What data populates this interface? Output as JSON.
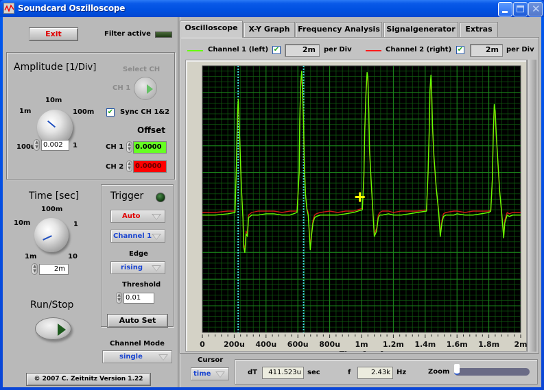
{
  "window": {
    "title": "Soundcard Oszilloscope",
    "controls": {
      "minimize": "minimize-icon",
      "maximize": "maximize-icon",
      "close": "close-icon"
    }
  },
  "left_panel": {
    "exit_label": "Exit",
    "filter_label": "Filter active",
    "amplitude": {
      "title": "Amplitude",
      "unit": "[1/Div]",
      "scale_labels": [
        "100u",
        "1m",
        "10m",
        "100m",
        "1"
      ],
      "value": "0.002"
    },
    "select_ch": {
      "title": "Select CH",
      "value_label": "CH 1"
    },
    "sync": {
      "label": "Sync CH 1&2",
      "checked": true
    },
    "offset": {
      "title": "Offset",
      "ch1_label": "CH 1",
      "ch1_value": "0.0000",
      "ch2_label": "CH 2",
      "ch2_value": "0.0000"
    },
    "time": {
      "title": "Time [sec]",
      "scale_labels": [
        "1m",
        "10m",
        "100m",
        "1",
        "10"
      ],
      "value": "2m"
    },
    "trigger": {
      "title": "Trigger",
      "mode": "Auto",
      "channel": "Channel 1",
      "edge_label": "Edge",
      "edge": "rising",
      "threshold_label": "Threshold",
      "threshold": "0.01",
      "auto_set_label": "Auto Set"
    },
    "run_stop_label": "Run/Stop",
    "channel_mode": {
      "label": "Channel Mode",
      "value": "single"
    },
    "copyright": "© 2007   C. Zeitnitz Version 1.22"
  },
  "tabs": [
    {
      "label": "Oscilloscope",
      "active": true
    },
    {
      "label": "X-Y Graph",
      "active": false
    },
    {
      "label": "Frequency Analysis",
      "active": false
    },
    {
      "label": "Signalgenerator",
      "active": false
    },
    {
      "label": "Extras",
      "active": false
    }
  ],
  "channels": [
    {
      "label": "Channel 1 (left)",
      "color": "#66ff00",
      "enabled": true,
      "per_div": "2m",
      "per_div_label": "per Div"
    },
    {
      "label": "Channel 2 (right)",
      "color": "#ff1a1a",
      "enabled": true,
      "per_div": "2m",
      "per_div_label": "per Div"
    }
  ],
  "cursor_panel": {
    "label": "Cursor",
    "mode": "time",
    "dt_label": "dT",
    "dt_value": "411.523u",
    "dt_unit": "sec",
    "f_label": "f",
    "f_value": "2.43k",
    "f_unit": "Hz",
    "zoom_label": "Zoom",
    "zoom_level": 0.0
  },
  "chart_data": {
    "type": "line",
    "title": "",
    "xlabel": "Time [sec]",
    "ylabel": "",
    "x_unit": "sec",
    "xlim": [
      0,
      0.002
    ],
    "ylim": [
      -10,
      10
    ],
    "y_unit": "mV (2m per Div, 10 divisions)",
    "x_ticks": [
      0,
      0.0002,
      0.0004,
      0.0006,
      0.0008,
      0.001,
      0.0012,
      0.0014,
      0.0016,
      0.0018,
      0.002
    ],
    "x_tick_labels": [
      "0",
      "200u",
      "400u",
      "600u",
      "800u",
      "1m",
      "1.2m",
      "1.4m",
      "1.6m",
      "1.8m",
      "2m"
    ],
    "grid": true,
    "background": "#000000",
    "grid_color": "#0f5a0f",
    "cursors": [
      {
        "x": 0.000225,
        "color": "#40e0e0",
        "style": "dotted"
      },
      {
        "x": 0.000636,
        "color": "#40e0e0",
        "style": "dotted"
      }
    ],
    "cursor_marker": {
      "x": 0.00099,
      "y": 0.0,
      "color": "#ffff00"
    },
    "series": [
      {
        "name": "Channel 1 (left)",
        "color": "#66ff00",
        "x": [
          0,
          8e-05,
          0.00016,
          0.000205,
          0.000214,
          0.000218,
          0.000222,
          0.000226,
          0.00023,
          0.000236,
          0.000245,
          0.000255,
          0.00026,
          0.000267,
          0.000275,
          0.000283,
          0.00029,
          0.00031,
          0.00035,
          0.0004,
          0.00045,
          0.0005,
          0.00055,
          0.000595,
          0.000608,
          0.000612,
          0.000618,
          0.000624,
          0.00063,
          0.000636,
          0.00064,
          0.000648,
          0.000657,
          0.000665,
          0.000678,
          0.000686,
          0.000695,
          0.000705,
          0.000715,
          0.00074,
          0.0008,
          0.00085,
          0.0009,
          0.00095,
          0.001005,
          0.001015,
          0.00102,
          0.001028,
          0.001035,
          0.00104,
          0.001046,
          0.00105,
          0.00106,
          0.00107,
          0.00108,
          0.001095,
          0.001105,
          0.001115,
          0.00113,
          0.00117,
          0.0012,
          0.00125,
          0.0013,
          0.00135,
          0.001408,
          0.001418,
          0.001425,
          0.00143,
          0.001436,
          0.00144,
          0.001446,
          0.001455,
          0.00147,
          0.001485,
          0.001495,
          0.001505,
          0.001515,
          0.00153,
          0.00158,
          0.0016,
          0.00165,
          0.0017,
          0.00175,
          0.0018,
          0.001812,
          0.001822,
          0.001828,
          0.001834,
          0.00184,
          0.001846,
          0.001856,
          0.001868,
          0.00188,
          0.001893,
          0.0019,
          0.001915,
          0.001928,
          0.00195,
          0.002
        ],
        "y": [
          -1.2,
          -1.2,
          -1.1,
          -1.0,
          2.5,
          5.0,
          6.8,
          7.5,
          6.2,
          4.0,
          1.0,
          -1.5,
          -3.6,
          -4.0,
          -2.6,
          -2.8,
          -1.4,
          -1.2,
          -1.2,
          -1.1,
          -1.1,
          -1.2,
          -1.2,
          -1.0,
          2.0,
          6.0,
          8.8,
          9.6,
          8.0,
          5.5,
          3.0,
          0.4,
          -0.8,
          -1.2,
          -3.8,
          -2.7,
          -1.8,
          -1.4,
          -1.3,
          -1.2,
          -1.2,
          -1.2,
          -1.1,
          -1.0,
          -0.8,
          1.8,
          5.0,
          8.0,
          9.5,
          9.1,
          6.5,
          3.8,
          1.5,
          -0.6,
          -2.8,
          -2.4,
          -1.4,
          -1.2,
          -1.2,
          -1.1,
          -1.2,
          -1.2,
          -1.1,
          -1.0,
          -0.9,
          2.0,
          5.0,
          8.2,
          9.3,
          8.4,
          5.5,
          3.2,
          0.8,
          -1.0,
          -2.8,
          -1.8,
          -1.3,
          -1.2,
          -1.2,
          -1.1,
          -1.2,
          -1.2,
          -1.1,
          -1.0,
          -0.9,
          1.5,
          5.0,
          7.1,
          6.6,
          5.0,
          3.0,
          0.6,
          -1.0,
          -2.9,
          -1.8,
          -1.2,
          -1.3,
          -1.2,
          -1.2
        ]
      },
      {
        "name": "Channel 2 (right)",
        "color": "#ff1a1a",
        "x": [
          0,
          8e-05,
          0.00016,
          0.000205,
          0.000214,
          0.000218,
          0.000222,
          0.000226,
          0.00023,
          0.000236,
          0.000245,
          0.000255,
          0.00026,
          0.000267,
          0.000275,
          0.000283,
          0.00029,
          0.00031,
          0.00035,
          0.0004,
          0.00045,
          0.0005,
          0.00055,
          0.000595,
          0.000608,
          0.000612,
          0.000618,
          0.000624,
          0.00063,
          0.000636,
          0.00064,
          0.000648,
          0.000657,
          0.000665,
          0.000678,
          0.000686,
          0.000695,
          0.000705,
          0.000715,
          0.00074,
          0.0008,
          0.00085,
          0.0009,
          0.00095,
          0.001005,
          0.001015,
          0.00102,
          0.001028,
          0.001035,
          0.00104,
          0.001046,
          0.00105,
          0.00106,
          0.00107,
          0.00108,
          0.001095,
          0.001105,
          0.001115,
          0.00113,
          0.00117,
          0.0012,
          0.00125,
          0.0013,
          0.00135,
          0.001408,
          0.001418,
          0.001425,
          0.00143,
          0.001436,
          0.00144,
          0.001446,
          0.001455,
          0.00147,
          0.001485,
          0.001495,
          0.001505,
          0.001515,
          0.00153,
          0.00158,
          0.0016,
          0.00165,
          0.0017,
          0.00175,
          0.0018,
          0.001812,
          0.001822,
          0.001828,
          0.001834,
          0.00184,
          0.001846,
          0.001856,
          0.001868,
          0.00188,
          0.001893,
          0.0019,
          0.001915,
          0.001928,
          0.00195,
          0.002
        ],
        "y": [
          -1.0,
          -1.0,
          -0.9,
          -0.9,
          2.4,
          4.8,
          6.5,
          7.3,
          6.0,
          3.8,
          0.9,
          -1.4,
          -3.4,
          -3.8,
          -2.4,
          -2.6,
          -1.2,
          -1.0,
          -0.9,
          -0.9,
          -0.9,
          -1.0,
          -0.9,
          -0.9,
          1.9,
          5.8,
          8.5,
          9.3,
          7.8,
          5.3,
          2.8,
          0.3,
          -0.7,
          -1.0,
          -3.6,
          -2.5,
          -1.6,
          -1.2,
          -1.1,
          -1.0,
          -0.9,
          -1.0,
          -0.9,
          -0.9,
          -0.7,
          1.7,
          4.8,
          7.8,
          9.3,
          8.9,
          6.3,
          3.6,
          1.4,
          -0.5,
          -2.6,
          -2.2,
          -1.2,
          -1.0,
          -0.9,
          -0.9,
          -1.0,
          -0.9,
          -0.9,
          -0.9,
          -0.8,
          1.9,
          4.8,
          8.0,
          9.1,
          8.2,
          5.3,
          3.0,
          0.7,
          -0.9,
          -2.6,
          -1.6,
          -1.1,
          -1.0,
          -0.9,
          -0.9,
          -1.0,
          -0.9,
          -0.9,
          -0.9,
          -0.8,
          1.4,
          4.8,
          6.9,
          6.4,
          4.8,
          2.8,
          0.5,
          -0.9,
          -2.7,
          -1.6,
          -1.0,
          -1.1,
          -1.0,
          -1.0
        ]
      }
    ]
  }
}
